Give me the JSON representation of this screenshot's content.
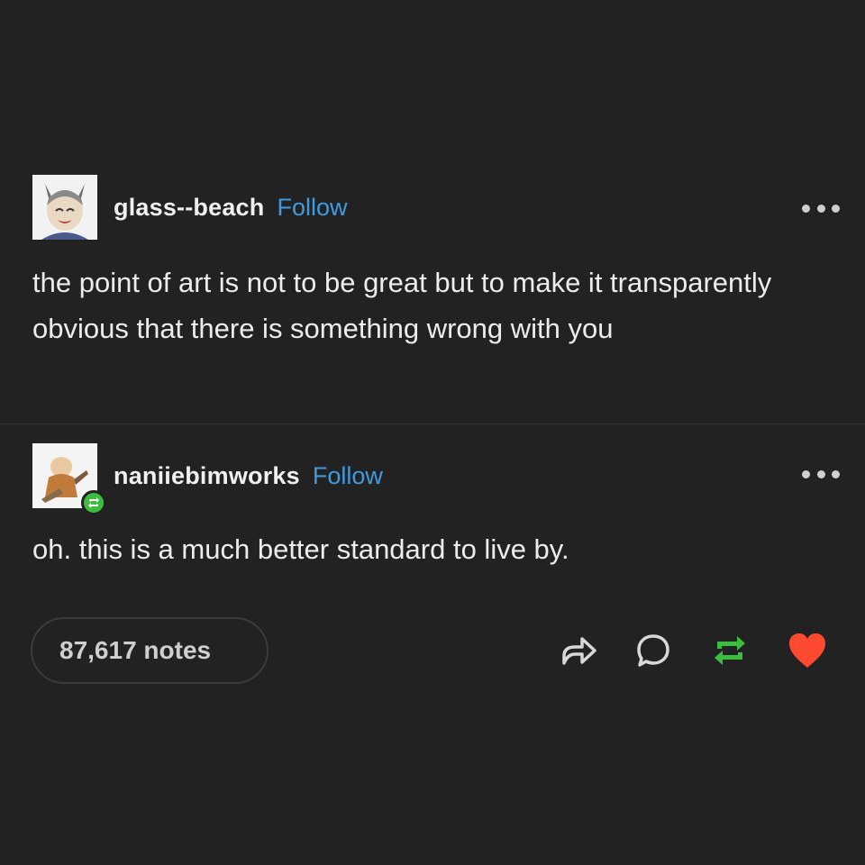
{
  "posts": [
    {
      "username": "glass--beach",
      "follow_label": "Follow",
      "text": "the point of art is not to be great but to make it transparently obvious that there is something wrong with you",
      "avatar_icon": "anime-character-avatar"
    },
    {
      "username": "naniiebimworks",
      "follow_label": "Follow",
      "text": "oh. this is a much better standard to live by.",
      "avatar_icon": "drawing-character-avatar",
      "badge_icon": "reblog-icon"
    }
  ],
  "footer": {
    "notes_label": "87,617 notes",
    "actions": [
      "share-icon",
      "comment-icon",
      "reblog-icon",
      "like-heart-icon"
    ]
  },
  "colors": {
    "background": "#222222",
    "text": "#ececec",
    "follow": "#3f9ae0",
    "reblog_green": "#3dbd3d",
    "like_red": "#ff4930"
  }
}
